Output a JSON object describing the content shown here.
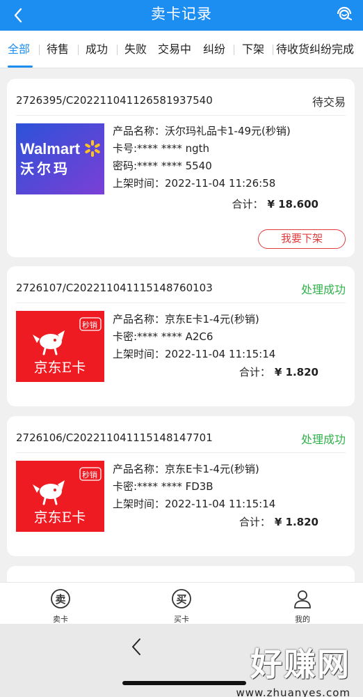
{
  "header": {
    "title": "卖卡记录",
    "back_icon": "back-chevron-icon",
    "service_icon": "customer-service-icon"
  },
  "tabs": [
    {
      "label": "全部",
      "active": true
    },
    {
      "label": "待售"
    },
    {
      "label": "成功"
    },
    {
      "label": "失败"
    },
    {
      "label": "交易中"
    },
    {
      "label": "纠纷"
    },
    {
      "label": "下架"
    },
    {
      "label": "待收货纠纷完成"
    }
  ],
  "records": [
    {
      "order_no": "2726395/C20221104112658193754​0",
      "status": "待交易",
      "status_color": "#333333",
      "card_brand": "Walmart",
      "card_brand_cn": "沃尔玛",
      "product_name": "产品名称：沃尔玛礼品卡1-49元(秒销)",
      "card_no": "卡号:**** **** ngth",
      "password": "密码:**** **** 5540",
      "listed_time": "上架时间：2022-11-04 11:26:58",
      "total_label": "合计：",
      "total_value": "¥ 18.600",
      "action": "我要下架"
    },
    {
      "order_no": "2726107/C202211041115148760103",
      "status": "处理成功",
      "status_color": "#2fb24a",
      "card_brand_cn": "京东E卡",
      "card_tag": "秒销",
      "product_name": "产品名称：京东E卡1-4元(秒销)",
      "password": "卡密:**** **** A2C6",
      "listed_time": "上架时间：2022-11-04 11:15:14",
      "total_label": "合计：",
      "total_value": "¥ 1.820"
    },
    {
      "order_no": "2726106/C202211041115148147701",
      "status": "处理成功",
      "status_color": "#2fb24a",
      "card_brand_cn": "京东E卡",
      "card_tag": "秒销",
      "product_name": "产品名称：京东E卡1-4元(秒销)",
      "password": "卡密:**** **** FD3B",
      "listed_time": "上架时间：2022-11-04 11:15:14",
      "total_label": "合计：",
      "total_value": "¥ 1.820"
    }
  ],
  "bottom_nav": [
    {
      "label": "卖卡",
      "icon": "sell-icon",
      "glyph": "卖"
    },
    {
      "label": "买卡",
      "icon": "buy-icon",
      "glyph": "买"
    },
    {
      "label": "我的",
      "icon": "user-icon"
    }
  ],
  "watermark": {
    "main": "好赚网",
    "url": "www.zhuanyes.com"
  },
  "colors": {
    "primary": "#1c8df1",
    "success": "#2fb24a",
    "danger": "#e03a3a",
    "walmart_blue": "#1f62d6",
    "walmart_yellow": "#ffc220",
    "jd_red": "#ee1b22"
  }
}
